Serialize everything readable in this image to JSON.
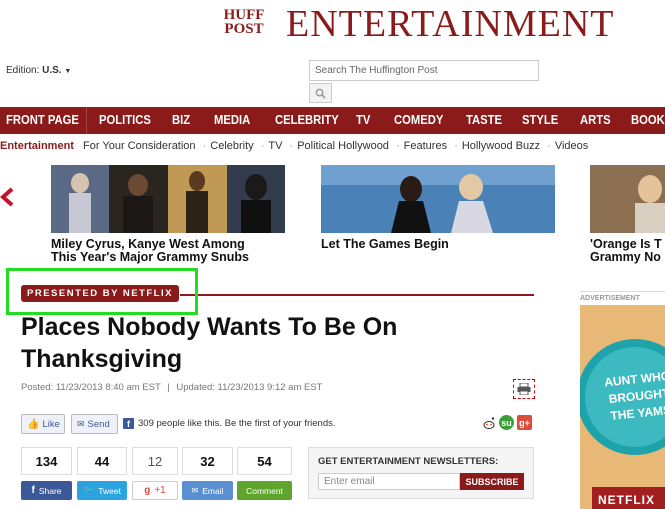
{
  "header": {
    "logo_huff": "HUFF",
    "logo_post": "POST",
    "section_title": "ENTERTAINMENT",
    "edition_label": "Edition:",
    "edition_value": "U.S.",
    "search_placeholder": "Search The Huffington Post"
  },
  "nav": {
    "items": [
      "FRONT PAGE",
      "POLITICS",
      "BIZ",
      "MEDIA",
      "CELEBRITY",
      "TV",
      "COMEDY",
      "TASTE",
      "STYLE",
      "ARTS",
      "BOOKS"
    ]
  },
  "subnav": {
    "section": "Entertainment",
    "items": [
      "For Your Consideration",
      "Celebrity",
      "TV",
      "Political Hollywood",
      "Features",
      "Hollywood Buzz",
      "Videos"
    ]
  },
  "carousel": {
    "prev_arrow": "‹",
    "items": [
      {
        "caption_line1": "Miley Cyrus, Kanye West Among",
        "caption_line2": "This Year's Major Grammy Snubs"
      },
      {
        "caption_line1": "Let The Games Begin",
        "caption_line2": ""
      },
      {
        "caption_line1": "'Orange Is T",
        "caption_line2": "Grammy No"
      }
    ]
  },
  "article": {
    "badge": "PRESENTED BY NETFLIX",
    "title_line1": "Places Nobody Wants To Be On",
    "title_line2": "Thanksgiving",
    "posted": "Posted: 11/23/2013 8:40 am EST",
    "separator": "|",
    "updated": "Updated: 11/23/2013 9:12 am EST"
  },
  "facebook": {
    "like_label": "Like",
    "send_label": "Send",
    "like_text": "309 people like this. Be the first of your friends."
  },
  "share": {
    "counts": [
      "134",
      "44",
      "12",
      "32",
      "54"
    ],
    "labels": [
      "Share",
      "Tweet",
      "+1",
      "Email",
      "Comment"
    ],
    "colors": [
      "#3b5998",
      "#2ba3e1",
      "#ffffff",
      "#5a8fd1",
      "#5fa52d"
    ]
  },
  "newsletter": {
    "title": "GET ENTERTAINMENT NEWSLETTERS:",
    "placeholder": "Enter email",
    "button": "SUBSCRIBE"
  },
  "ad": {
    "label": "ADVERTISEMENT",
    "text_line1": "AUNT WHO",
    "text_line2": "BROUGHT",
    "text_line3": "THE YAMS",
    "brand": "NETFLIX"
  },
  "colors": {
    "brand": "#8b1a1a",
    "highlight": "#22dd22"
  }
}
